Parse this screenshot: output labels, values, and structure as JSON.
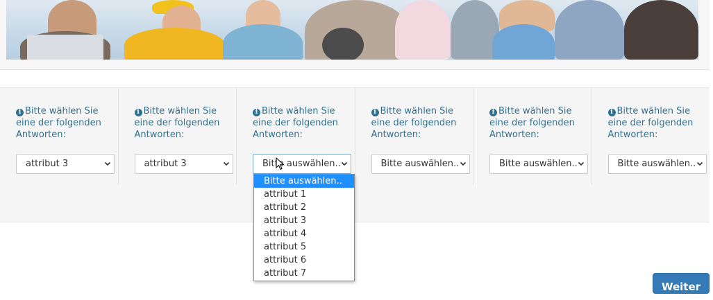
{
  "banner": {
    "image": "photo-collage-people"
  },
  "questions": [
    {
      "prompt": "Bitte wählen Sie eine der folgenden Antworten:",
      "value": "attribut 3"
    },
    {
      "prompt": "Bitte wählen Sie eine der folgenden Antworten:",
      "value": "attribut 3"
    },
    {
      "prompt": "Bitte wählen Sie eine der folgenden Antworten:",
      "value": "Bitte auswählen.."
    },
    {
      "prompt": "Bitte wählen Sie eine der folgenden Antworten:",
      "value": "Bitte auswählen.."
    },
    {
      "prompt": "Bitte wählen Sie eine der folgenden Antworten:",
      "value": "Bitte auswählen.."
    },
    {
      "prompt": "Bitte wählen Sie eine der folgenden Antworten:",
      "value": "Bitte auswählen.."
    }
  ],
  "dropdown": {
    "options": [
      "Bitte auswählen..",
      "attribut 1",
      "attribut 2",
      "attribut 3",
      "attribut 4",
      "attribut 5",
      "attribut 6",
      "attribut 7"
    ],
    "highlighted": "Bitte auswählen.."
  },
  "next_button": {
    "label": "Weiter"
  },
  "colors": {
    "info": "#31708f",
    "primary": "#337ab7",
    "highlight": "#1e90ff"
  }
}
